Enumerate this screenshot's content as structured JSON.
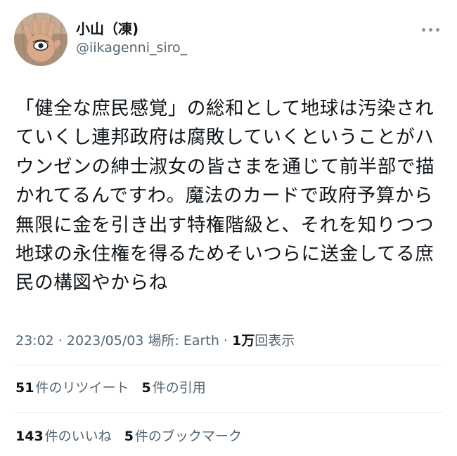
{
  "author": {
    "display_name": "小山（凍)",
    "handle": "@iikagenni_siro_"
  },
  "tweet": {
    "text": "「健全な庶民感覚」の総和として地球は汚染され\nていくし連邦政府は腐敗していくということがハ\nウンゼンの紳士淑女の皆さまを通じて前半部で描\nかれてるんですわ。魔法のカードで政府予算から\n無限に金を引き出す特権階級と、それを知りつつ\n地球の永住権を得るためそいつらに送金してる庶\n民の構図やからね"
  },
  "meta": {
    "time": "23:02",
    "separator1": " · ",
    "date": "2023/05/03",
    "location_label": "場所: ",
    "location": "Earth",
    "separator2": " · ",
    "views_count": "1万",
    "views_label": "回表示"
  },
  "stats": {
    "retweets_count": "51",
    "retweets_label": "件のリツイート",
    "quotes_count": "5",
    "quotes_label": "件の引用",
    "likes_count": "143",
    "likes_label": "件のいいね",
    "bookmarks_count": "5",
    "bookmarks_label": "件のブックマーク"
  },
  "icons": {
    "more": "more-dots-icon",
    "avatar": "hand-eye-avatar"
  },
  "colors": {
    "text_primary": "#0f1419",
    "text_secondary": "#536471",
    "divider": "#e6e9eb"
  }
}
